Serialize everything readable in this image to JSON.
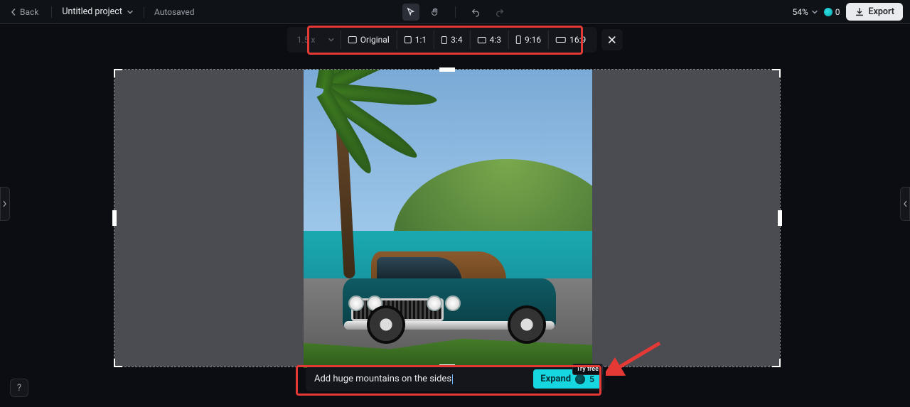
{
  "header": {
    "back_label": "Back",
    "project_name": "Untitled project",
    "autosaved": "Autosaved",
    "zoom": "54%",
    "credits": "0",
    "export_label": "Export"
  },
  "aspect_toolbar": {
    "scale_value": "1.5 x",
    "ratios": [
      {
        "label": "Original",
        "w": 12,
        "h": 10
      },
      {
        "label": "1:1",
        "w": 10,
        "h": 10
      },
      {
        "label": "3:4",
        "w": 8,
        "h": 11
      },
      {
        "label": "4:3",
        "w": 12,
        "h": 9
      },
      {
        "label": "9:16",
        "w": 7,
        "h": 12
      },
      {
        "label": "16:9",
        "w": 14,
        "h": 8
      }
    ]
  },
  "prompt": {
    "text": "Add huge mountains on the sides",
    "expand_label": "Expand",
    "expand_cost": "5",
    "try_free": "Try free"
  },
  "help_label": "?"
}
